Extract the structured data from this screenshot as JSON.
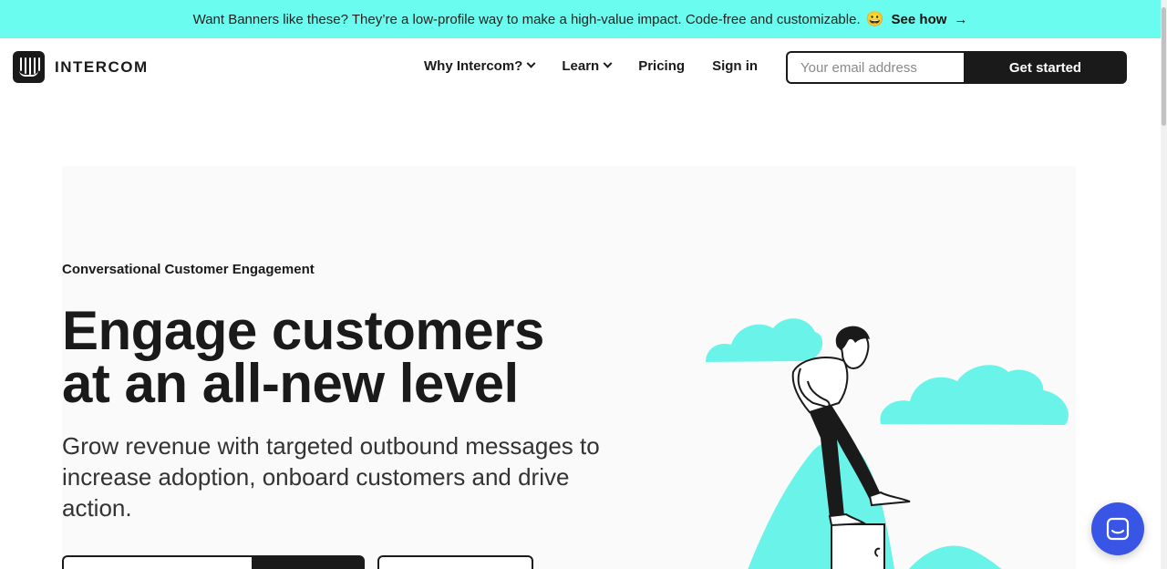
{
  "banner": {
    "message": "Want Banners like these? They’re a low-profile way to make a high-value impact. Code-free and customizable.",
    "emoji": "😀",
    "link_label": "See how",
    "arrow": "→",
    "background": "#6afdef"
  },
  "header": {
    "logo_text": "INTERCOM",
    "nav": [
      {
        "label": "Why Intercom?",
        "has_dropdown": true
      },
      {
        "label": "Learn",
        "has_dropdown": true
      },
      {
        "label": "Pricing",
        "has_dropdown": false
      },
      {
        "label": "Sign in",
        "has_dropdown": false
      }
    ],
    "email_placeholder": "Your email address",
    "cta_label": "Get started"
  },
  "hero": {
    "eyebrow": "Conversational Customer Engagement",
    "headline_line1": "Engage customers",
    "headline_line2": "at an all-new level",
    "subhead": "Grow revenue with targeted outbound messages to increase adoption, onboard customers and drive action."
  },
  "colors": {
    "accent_teal": "#6afdef",
    "dark": "#1a1a1a",
    "chat_blue": "#3855e6"
  },
  "chat_launcher": {
    "icon": "chat-bubble-icon"
  }
}
